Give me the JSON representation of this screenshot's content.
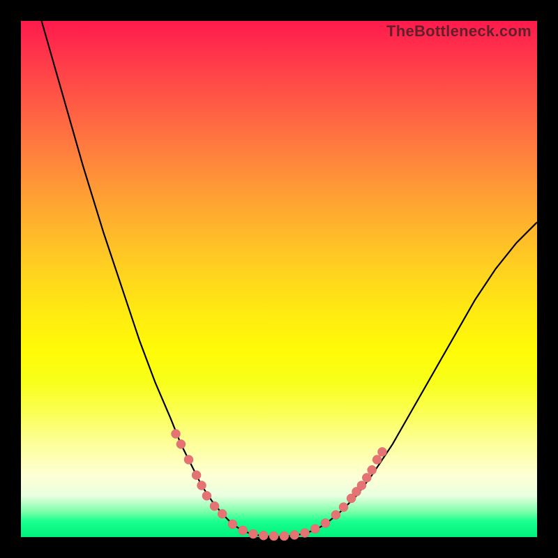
{
  "watermark": "TheBottleneck.com",
  "colors": {
    "frame": "#000000",
    "curve": "#000000",
    "dot": "#e57373"
  },
  "chart_data": {
    "type": "line",
    "title": "",
    "xlabel": "",
    "ylabel": "",
    "xlim": [
      0,
      100
    ],
    "ylim": [
      0,
      100
    ],
    "series": [
      {
        "name": "left-branch",
        "x": [
          4,
          8,
          12,
          16,
          20,
          23,
          26,
          29,
          31,
          33,
          35,
          37,
          39,
          41,
          43,
          45
        ],
        "y": [
          100,
          86,
          72,
          59,
          47,
          38,
          30,
          23,
          18,
          14,
          10,
          7,
          4.5,
          2.5,
          1.2,
          0.5
        ]
      },
      {
        "name": "valley",
        "x": [
          45,
          47,
          49,
          51,
          53,
          55,
          57,
          59
        ],
        "y": [
          0.5,
          0.2,
          0.1,
          0.1,
          0.3,
          0.7,
          1.4,
          2.5
        ]
      },
      {
        "name": "right-branch",
        "x": [
          59,
          62,
          65,
          68,
          72,
          76,
          80,
          84,
          88,
          92,
          96,
          100
        ],
        "y": [
          2.5,
          5,
          8,
          12,
          18,
          25,
          32,
          39,
          46,
          52,
          57,
          61
        ]
      }
    ],
    "points": [
      {
        "x": 30,
        "y": 20
      },
      {
        "x": 31,
        "y": 18
      },
      {
        "x": 32.5,
        "y": 15
      },
      {
        "x": 34,
        "y": 12
      },
      {
        "x": 35,
        "y": 10
      },
      {
        "x": 36,
        "y": 8
      },
      {
        "x": 37.5,
        "y": 6
      },
      {
        "x": 39,
        "y": 4.5
      },
      {
        "x": 41,
        "y": 2.5
      },
      {
        "x": 43,
        "y": 1.3
      },
      {
        "x": 45,
        "y": 0.6
      },
      {
        "x": 47,
        "y": 0.3
      },
      {
        "x": 49,
        "y": 0.2
      },
      {
        "x": 51,
        "y": 0.2
      },
      {
        "x": 53,
        "y": 0.4
      },
      {
        "x": 55,
        "y": 0.8
      },
      {
        "x": 57,
        "y": 1.6
      },
      {
        "x": 59,
        "y": 2.7
      },
      {
        "x": 61,
        "y": 4.3
      },
      {
        "x": 62.5,
        "y": 5.8
      },
      {
        "x": 64,
        "y": 7.5
      },
      {
        "x": 65,
        "y": 8.8
      },
      {
        "x": 66,
        "y": 10
      },
      {
        "x": 67,
        "y": 11.5
      },
      {
        "x": 68,
        "y": 13
      },
      {
        "x": 69,
        "y": 15
      },
      {
        "x": 70,
        "y": 16.5
      }
    ]
  }
}
